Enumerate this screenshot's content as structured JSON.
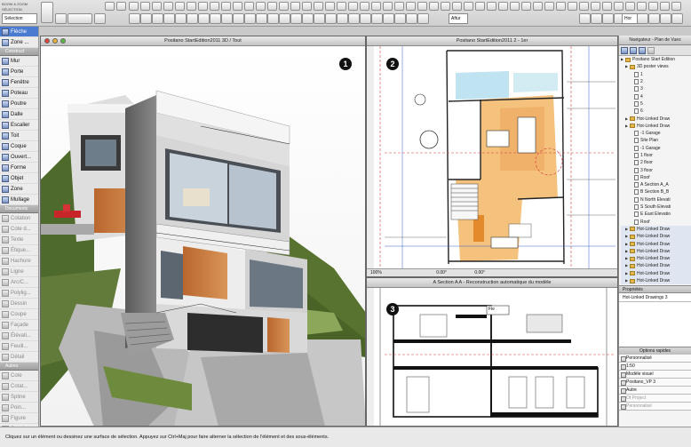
{
  "toolbar": {
    "top_left_label_1": "BOOM & ZOOM",
    "top_left_label_2": "SÉLECTION",
    "selection_button": "Sélection",
    "zoom_value": "Zone...",
    "unit_select": "Aftur",
    "layer_select": "Hor"
  },
  "palette": {
    "selection_title": "",
    "items_main": [
      {
        "label": "Flèche",
        "icon": "arrow-pointer-icon",
        "selected": true
      },
      {
        "label": "Zone ...",
        "icon": "zoom-icon",
        "selected": false
      }
    ],
    "construct_title": "",
    "items_construct": [
      {
        "label": "Mur",
        "icon": "wall-icon"
      },
      {
        "label": "Porte",
        "icon": "door-icon"
      },
      {
        "label": "Fenêtre",
        "icon": "window-icon"
      },
      {
        "label": "Poteau",
        "icon": "column-icon"
      },
      {
        "label": "Poutre",
        "icon": "beam-icon"
      },
      {
        "label": "Dalle",
        "icon": "slab-icon"
      },
      {
        "label": "Escalier",
        "icon": "stair-icon"
      },
      {
        "label": "Toit",
        "icon": "roof-icon"
      },
      {
        "label": "Coque",
        "icon": "shell-icon"
      },
      {
        "label": "Ouvert...",
        "icon": "opening-icon"
      },
      {
        "label": "Forme",
        "icon": "morph-icon"
      },
      {
        "label": "Objet",
        "icon": "object-icon"
      },
      {
        "label": "Zone",
        "icon": "zone-icon"
      },
      {
        "label": "Mullage",
        "icon": "mesh-icon"
      }
    ],
    "documents_title": "Documents",
    "items_documents": [
      "Cotation",
      "Cote d...",
      "Texte",
      "Étique...",
      "Hachure",
      "Ligne",
      "Arc/C...",
      "Polylig...",
      "Dessin",
      "Coupe",
      "Façade",
      "Élévati...",
      "Feuill...",
      "Détail"
    ],
    "autres_title": "Autres",
    "items_autres": [
      "Cote",
      "Cotat...",
      "Spline",
      "Poin...",
      "Figure",
      "Camé..."
    ]
  },
  "window_3d": {
    "title": "Positano StartEdition2011 3D / Tout",
    "badge": "1"
  },
  "window_plan": {
    "title": "Positano StartEdition2011 2 - 1er",
    "badge": "2",
    "zoom": "100%",
    "status_values": [
      "0.00°",
      "0.00°"
    ]
  },
  "window_section": {
    "title": "A Section A A - Reconstruction automatique du modèle",
    "badge": "3",
    "label_tag": "Fle"
  },
  "navigator": {
    "title": "Navigateur - Plan de Vues",
    "items": [
      {
        "label": "Positano Start Edition",
        "type": "folder",
        "depth": 0
      },
      {
        "label": "3D poster views",
        "type": "folder",
        "depth": 1
      },
      {
        "label": "1",
        "type": "page",
        "depth": 2
      },
      {
        "label": "2",
        "type": "page",
        "depth": 2
      },
      {
        "label": "3",
        "type": "page",
        "depth": 2
      },
      {
        "label": "4",
        "type": "page",
        "depth": 2
      },
      {
        "label": "5",
        "type": "page",
        "depth": 2
      },
      {
        "label": "6",
        "type": "page",
        "depth": 2
      },
      {
        "label": "Hot-Linked Draw",
        "type": "folder",
        "depth": 1
      },
      {
        "label": "Hot-Linked Draw",
        "type": "folder",
        "depth": 1
      },
      {
        "label": "-1 Garage",
        "type": "page",
        "depth": 2
      },
      {
        "label": "Site Plan",
        "type": "page",
        "depth": 2
      },
      {
        "label": "-1 Garage",
        "type": "page",
        "depth": 2
      },
      {
        "label": "1 floor",
        "type": "page",
        "depth": 2
      },
      {
        "label": "2 floor",
        "type": "page",
        "depth": 2
      },
      {
        "label": "3 floor",
        "type": "page",
        "depth": 2
      },
      {
        "label": "Roof",
        "type": "page",
        "depth": 2
      },
      {
        "label": "A Section A_A",
        "type": "page",
        "depth": 2
      },
      {
        "label": "B Section B_B",
        "type": "page",
        "depth": 2
      },
      {
        "label": "N North Elevati",
        "type": "page",
        "depth": 2
      },
      {
        "label": "S South Elevati",
        "type": "page",
        "depth": 2
      },
      {
        "label": "E East Elevatio",
        "type": "page",
        "depth": 2
      },
      {
        "label": "Roof",
        "type": "page",
        "depth": 2
      },
      {
        "label": "Hot-Linked Draw",
        "type": "folder",
        "depth": 1
      },
      {
        "label": "Hot-Linked Draw",
        "type": "folder",
        "depth": 1
      },
      {
        "label": "Hot-Linked Draw",
        "type": "folder",
        "depth": 1
      },
      {
        "label": "Hot-Linked Draw",
        "type": "folder",
        "depth": 1
      },
      {
        "label": "Hot-Linked Draw",
        "type": "folder",
        "depth": 1
      },
      {
        "label": "Hot-Linked Draw",
        "type": "folder",
        "depth": 1
      },
      {
        "label": "Hot-Linked Draw",
        "type": "folder",
        "depth": 1
      },
      {
        "label": "Hot-Linked Draw",
        "type": "folder",
        "depth": 1
      }
    ],
    "prop_header": "Propriétés",
    "prop_value": "Hot-Linked Drawings 3",
    "options_header": "Options rapides",
    "options": [
      {
        "label": "Personnalisé",
        "gray": false
      },
      {
        "label": "1:50",
        "gray": false
      },
      {
        "label": "Modèle visuel",
        "gray": false
      },
      {
        "label": "Positano_VP 3",
        "gray": false
      },
      {
        "label": "Autre",
        "gray": false
      },
      {
        "label": "Ot Project",
        "gray": true
      },
      {
        "label": "Personnalisé",
        "gray": true
      }
    ]
  },
  "status_bar": {
    "text": "Cliquez sur un élément ou dessinez une surface de sélection. Appuyez sur Ctrl+Maj pour faire alterner la sélection de l'élément et des sous-éléments."
  }
}
